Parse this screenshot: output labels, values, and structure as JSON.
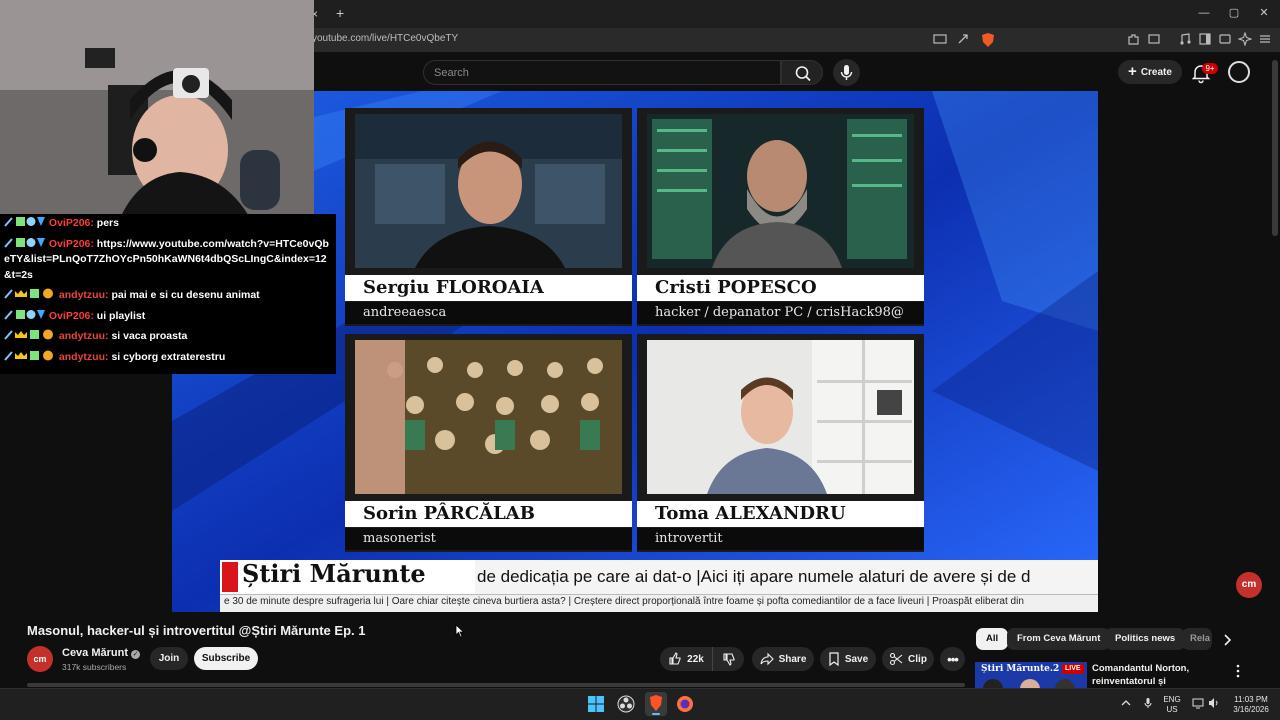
{
  "browser": {
    "tab_close": "×",
    "new_tab": "+",
    "url": "youtube.com/live/HTCe0vQbeTY",
    "window_controls": [
      "—",
      "▢",
      "✕"
    ]
  },
  "yt_header": {
    "search_placeholder": "Search",
    "create_label": "Create",
    "notifications_badge": "9+"
  },
  "chat": [
    {
      "user": "OviP206",
      "message": "pers",
      "badges": [
        "sword-icon",
        "cube-icon",
        "diamond-icon"
      ]
    },
    {
      "user": "OviP206",
      "message": "https://www.youtube.com/watch?v=HTCe0vQbeTY&list=PLnQoT7ZhOYcPn50hKaWN6t4dbQScLIngC&index=12&t=2s",
      "badges": [
        "sword-icon",
        "cube-icon",
        "diamond-icon"
      ]
    },
    {
      "user": "andytzuu",
      "message": "pai mai e si cu desenu animat",
      "badges": [
        "sword-icon",
        "crown-icon",
        "cube-icon",
        "coin-icon"
      ]
    },
    {
      "user": "OviP206",
      "message": "ui playlist",
      "badges": [
        "sword-icon",
        "cube-icon",
        "diamond-icon"
      ]
    },
    {
      "user": "andytzuu",
      "message": "si vaca proasta",
      "badges": [
        "sword-icon",
        "crown-icon",
        "cube-icon",
        "coin-icon"
      ]
    },
    {
      "user": "andytzuu",
      "message": "si cyborg extraterestru",
      "badges": [
        "sword-icon",
        "crown-icon",
        "cube-icon",
        "coin-icon"
      ]
    }
  ],
  "video": {
    "panels": [
      {
        "name": "Sergiu FLOROAIA",
        "subtitle": "andreeaesca"
      },
      {
        "name": "Cristi POPESCO",
        "subtitle": "hacker / depanator PC / crisHack98@"
      },
      {
        "name": "Sorin PÂRCĂLAB",
        "subtitle": "masonerist"
      },
      {
        "name": "Toma ALEXANDRU",
        "subtitle": "introvertit"
      }
    ],
    "brand": "Știri Mărunte",
    "ticker_main": "de dedicația pe care ai dat-o |Aici iți apare numele alaturi de avere și de d",
    "ticker_sub": "e 30 de minute despre sufrageria lui |   Oare chiar citește cineva burtiera asta?  |   Creștere direct proporțională între foame și pofta comediantilor de a face liveuri  |  Proaspăt eliberat  din",
    "float_logo": "cm"
  },
  "below_video": {
    "title": "Masonul, hacker-ul și introvertitul @Știri Mărunte Ep. 1",
    "channel_avatar": "cm",
    "channel_name": "Ceva Mărunt",
    "subscribers": "317k subscribers",
    "join": "Join",
    "subscribe": "Subscribe",
    "likes": "22k",
    "share": "Share",
    "save": "Save",
    "clip": "Clip"
  },
  "sidebar": {
    "chips": [
      "All",
      "From Ceva Mărunt",
      "Politics news",
      "Rela"
    ],
    "related_thumb_text": "Știri Mărunte.2",
    "related_live_badge": "LIVE",
    "related_title": "Comandantul Norton, reinventatorul și dezdecoratorul..."
  },
  "taskbar": {
    "lang_top": "ENG",
    "lang_bottom": "US",
    "time": "11:03 PM",
    "date": "3/16/2026"
  },
  "colors": {
    "yt_red": "#cc0000",
    "brand_red": "#d9141a",
    "studio_blue": "#0a2a9c",
    "chat_user": "#ff3b3b"
  }
}
